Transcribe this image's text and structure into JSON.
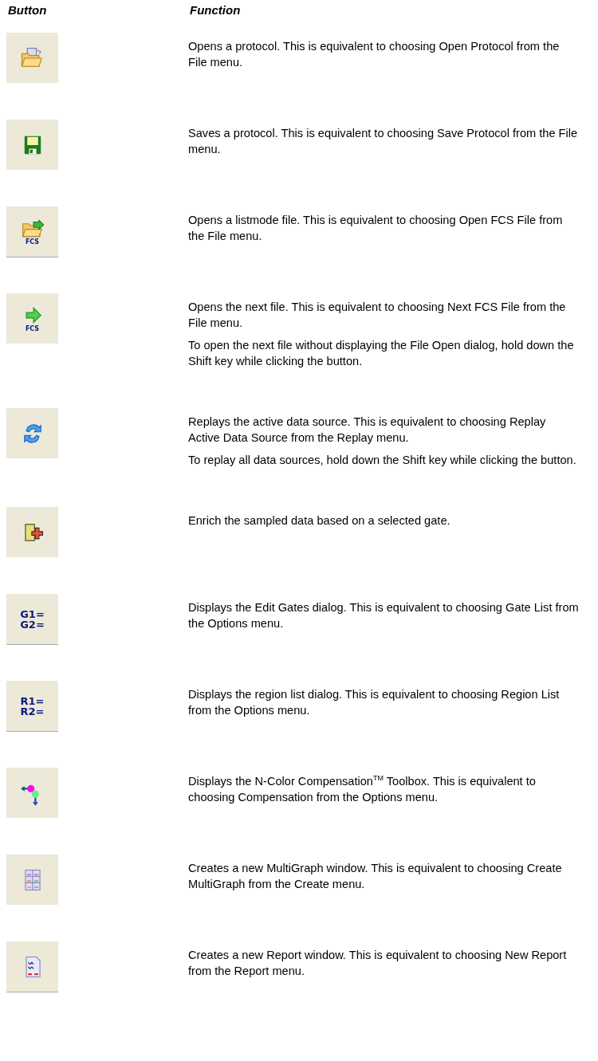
{
  "header": {
    "button": "Button",
    "function": "Function"
  },
  "rows": [
    {
      "kind": "open-protocol",
      "icon_text": [],
      "paragraphs": [
        "Opens a protocol.  This is equivalent to choosing Open Protocol from the File menu."
      ]
    },
    {
      "kind": "save",
      "icon_text": [],
      "paragraphs": [
        "Saves a protocol.  This is equivalent to choosing Save Protocol from the File menu."
      ]
    },
    {
      "kind": "openfcs",
      "icon_text": [
        "FCS"
      ],
      "paragraphs": [
        "Opens a listmode file.  This is equivalent to choosing Open FCS File from the File menu."
      ]
    },
    {
      "kind": "nextfcs",
      "icon_text": [
        "FCS"
      ],
      "paragraphs": [
        "Opens the next file.  This is equivalent to choosing Next FCS File from the File menu.",
        "To open the next file without displaying the File Open dialog, hold down the Shift key while clicking the button."
      ]
    },
    {
      "kind": "replay",
      "icon_text": [],
      "paragraphs": [
        "Replays the active data source.  This is equivalent to choosing Replay Active Data Source from the Replay menu.",
        "To replay all data sources, hold down the Shift key while clicking the button."
      ]
    },
    {
      "kind": "enrich",
      "icon_text": [],
      "paragraphs": [
        "Enrich the sampled data based on a selected gate."
      ]
    },
    {
      "kind": "list",
      "icon_text": [
        "G1=",
        "G2="
      ],
      "paragraphs": [
        "Displays the Edit Gates dialog.  This is equivalent to choosing Gate List from the Options menu."
      ]
    },
    {
      "kind": "list",
      "icon_text": [
        "R1=",
        "R2="
      ],
      "paragraphs": [
        "Displays the region list dialog.  This is equivalent to choosing Region List from the Options menu."
      ]
    },
    {
      "kind": "compensation",
      "icon_text": [],
      "paragraphs": [
        "Displays the N-Color Compensation$^{TM}$ Toolbox.  This is equivalent to choosing Compensation from the Options menu."
      ]
    },
    {
      "kind": "multigraph",
      "icon_text": [],
      "paragraphs": [
        "Creates a new MultiGraph window.  This is equivalent to choosing Create MultiGraph from the Create menu."
      ]
    },
    {
      "kind": "report",
      "icon_text": [],
      "paragraphs": [
        "Creates a new Report window.  This is equivalent to choosing New Report from the Report menu."
      ]
    }
  ]
}
